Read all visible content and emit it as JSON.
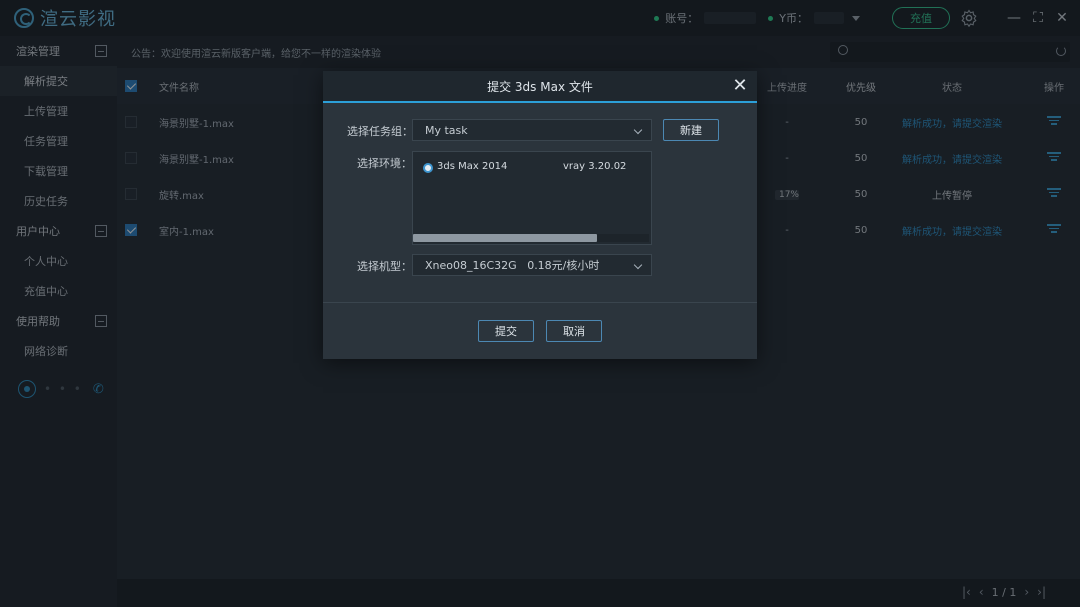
{
  "app": {
    "logo_text": "渲云影视",
    "account_label": "账号：",
    "coin_label": "Y币：",
    "recharge_label": "充值",
    "minimize": "—",
    "maximize": "⛶",
    "close": "✕"
  },
  "sidebar": {
    "groups": [
      {
        "label": "渲染管理",
        "items": [
          "解析提交",
          "上传管理",
          "任务管理",
          "下载管理",
          "历史任务"
        ]
      },
      {
        "label": "用户中心",
        "items": [
          "个人中心",
          "充值中心"
        ]
      },
      {
        "label": "使用帮助",
        "items": [
          "网络诊断"
        ]
      }
    ],
    "active_item": "解析提交",
    "status_dots": "• • •"
  },
  "notice": "公告：欢迎使用渲云新版客户端，给您不一样的渲染体验",
  "table": {
    "headers": {
      "name": "文件名称",
      "progress": "上传进度",
      "priority": "优先级",
      "status": "状态",
      "op": "操作"
    },
    "rows": [
      {
        "name": "海景别墅-1.max",
        "progress": "-",
        "priority": "50",
        "status": "解析成功，请提交渲染",
        "checked": false
      },
      {
        "name": "海景别墅-1.max",
        "progress": "-",
        "priority": "50",
        "status": "解析成功，请提交渲染",
        "checked": false
      },
      {
        "name": "旋转.max",
        "progress": "17%",
        "priority": "50",
        "status": "上传暂停",
        "checked": false
      },
      {
        "name": "室内-1.max",
        "progress": "-",
        "priority": "50",
        "status": "解析成功，请提交渲染",
        "checked": true
      }
    ]
  },
  "pager": {
    "text": "1 / 1"
  },
  "modal": {
    "title": "提交 3ds Max 文件",
    "task_group_label": "选择任务组：",
    "task_group_value": "My task",
    "new_button": "新建",
    "env_label": "选择环境：",
    "env_software": "3ds Max 2014",
    "env_renderer": "vray 3.20.02",
    "machine_label": "选择机型：",
    "machine_value": "Xneo08_16C32G   0.18元/核小时",
    "submit_button": "提交",
    "cancel_button": "取消"
  },
  "colors": {
    "accent": "#2c9fd8",
    "success": "#33c48f",
    "link": "#2f90c8"
  }
}
